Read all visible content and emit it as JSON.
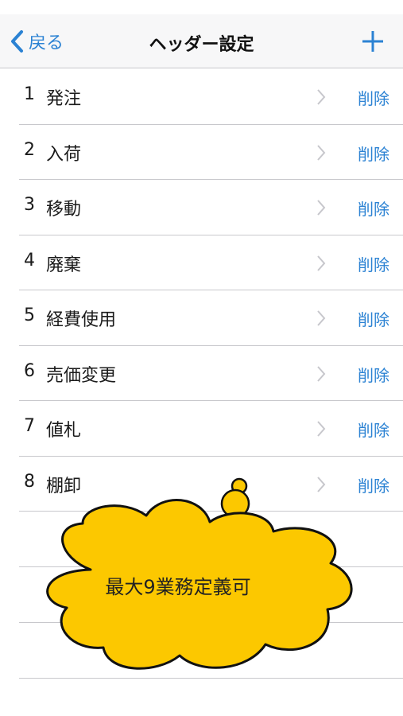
{
  "navbar": {
    "back_label": "戻る",
    "title": "ヘッダー設定",
    "add_icon": "plus-icon",
    "accent_color": "#2b82d3"
  },
  "headers": [
    {
      "number": "1",
      "label": "発注",
      "delete_label": "削除"
    },
    {
      "number": "2",
      "label": "入荷",
      "delete_label": "削除"
    },
    {
      "number": "3",
      "label": "移動",
      "delete_label": "削除"
    },
    {
      "number": "4",
      "label": "廃棄",
      "delete_label": "削除"
    },
    {
      "number": "5",
      "label": "経費使用",
      "delete_label": "削除"
    },
    {
      "number": "6",
      "label": "売価変更",
      "delete_label": "削除"
    },
    {
      "number": "7",
      "label": "値札",
      "delete_label": "削除"
    },
    {
      "number": "8",
      "label": "棚卸",
      "delete_label": "削除"
    }
  ],
  "callout": {
    "text": "最大9業務定義可",
    "fill_color": "#fcc800"
  }
}
